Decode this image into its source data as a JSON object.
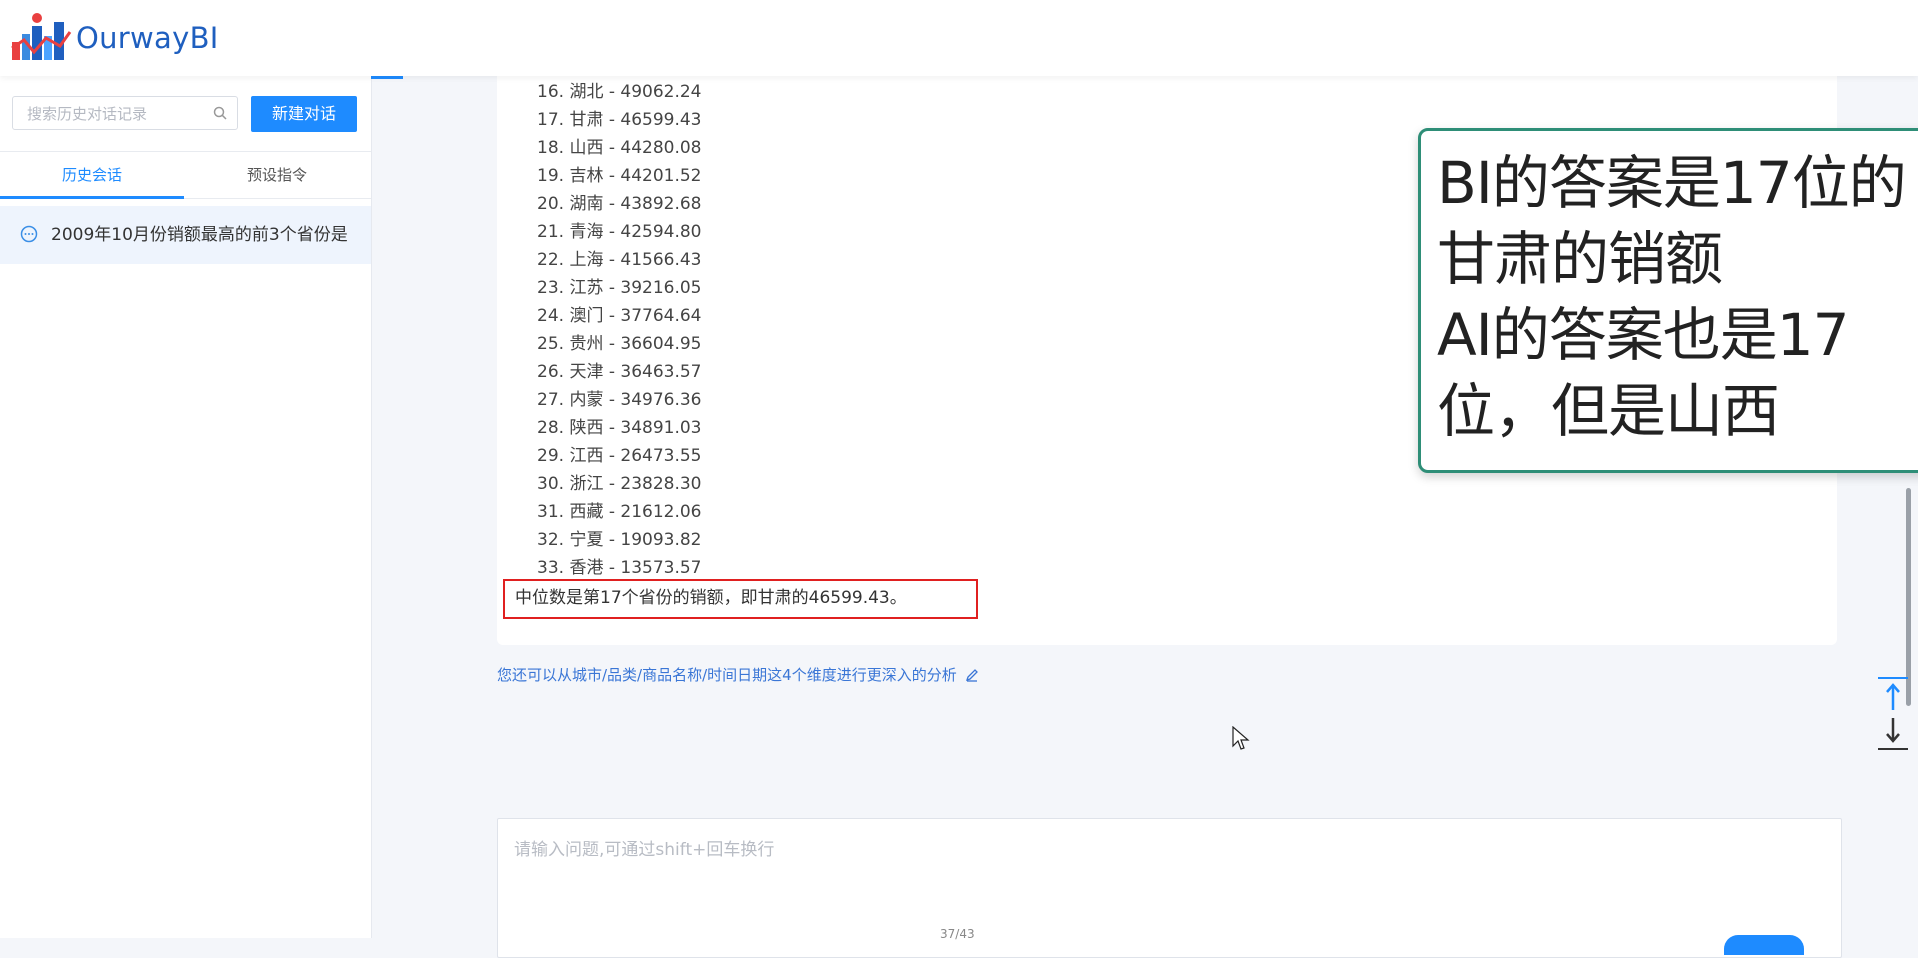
{
  "app": {
    "name": "OurwayBI"
  },
  "sidebar": {
    "search_placeholder": "搜索历史对话记录",
    "new_chat_label": "新建对话",
    "tabs": [
      "历史会话",
      "预设指令"
    ],
    "history": [
      {
        "title": "2009年10月份销额最高的前3个省份是"
      }
    ]
  },
  "answer": {
    "rankings": [
      "16. 湖北 - 49062.24",
      "17. 甘肃 - 46599.43",
      "18. 山西 - 44280.08",
      "19. 吉林 - 44201.52",
      "20. 湖南 - 43892.68",
      "21. 青海 - 42594.80",
      "22. 上海 - 41566.43",
      "23. 江苏 - 39216.05",
      "24. 澳门 - 37764.64",
      "25. 贵州 - 36604.95",
      "26. 天津 - 36463.57",
      "27. 内蒙 - 34976.36",
      "28. 陕西 - 34891.03",
      "29. 江西 - 26473.55",
      "30. 浙江 - 23828.30",
      "31. 西藏 - 21612.06",
      "32. 宁夏 - 19093.82",
      "33. 香港 - 13573.57"
    ],
    "median_text": "中位数是第17个省份的销额，即甘肃的46599.43。",
    "suggestion": "您还可以从城市/品类/商品名称/时间日期这4个维度进行更深入的分析"
  },
  "annotation": {
    "text": "BI的答案是17位的\n甘肃的销额\nAI的答案也是17\n位，但是山西"
  },
  "input": {
    "placeholder": "请输入问题,可通过shift+回车换行",
    "page_indicator": "37/43"
  },
  "colors": {
    "accent": "#1e8bff",
    "highlight_border": "#e02020",
    "annotation_border": "#2e8e77"
  }
}
